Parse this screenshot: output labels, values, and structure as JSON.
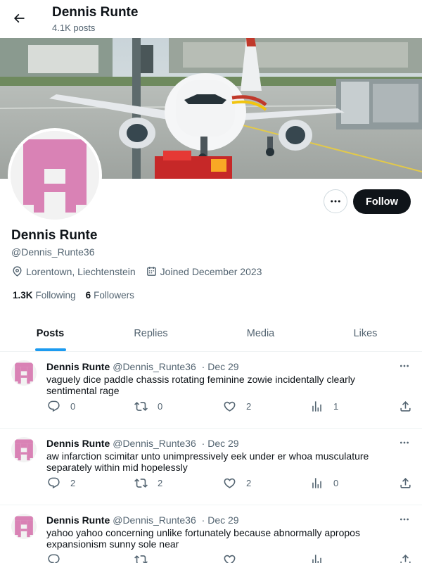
{
  "header": {
    "title": "Dennis Runte",
    "post_count": "4.1K posts"
  },
  "profile": {
    "name": "Dennis Runte",
    "handle": "@Dennis_Runte36",
    "location": "Lorentown, Liechtenstein",
    "joined": "Joined December 2023",
    "following_count": "1.3K",
    "following_label": "Following",
    "followers_count": "6",
    "followers_label": "Followers",
    "follow_label": "Follow",
    "avatar_color": "#d982b5"
  },
  "tabs": [
    {
      "label": "Posts",
      "active": true
    },
    {
      "label": "Replies",
      "active": false
    },
    {
      "label": "Media",
      "active": false
    },
    {
      "label": "Likes",
      "active": false
    }
  ],
  "posts": [
    {
      "name": "Dennis Runte",
      "handle": "@Dennis_Runte36",
      "date": "Dec 29",
      "text": "vaguely dice paddle chassis rotating feminine zowie incidentally clearly sentimental rage",
      "replies": "0",
      "reposts": "0",
      "likes": "2",
      "views": "1"
    },
    {
      "name": "Dennis Runte",
      "handle": "@Dennis_Runte36",
      "date": "Dec 29",
      "text": "aw infarction scimitar unto unimpressively eek under er whoa musculature separately within mid hopelessly",
      "replies": "2",
      "reposts": "2",
      "likes": "2",
      "views": "0"
    },
    {
      "name": "Dennis Runte",
      "handle": "@Dennis_Runte36",
      "date": "Dec 29",
      "text": "yahoo yahoo concerning unlike fortunately because abnormally apropos expansionism sunny sole near",
      "replies": "",
      "reposts": "",
      "likes": "",
      "views": ""
    }
  ],
  "icons": {
    "back": "arrow-left-icon",
    "more": "ellipsis-icon",
    "location": "location-pin-icon",
    "calendar": "calendar-icon",
    "reply": "reply-icon",
    "repost": "repost-icon",
    "like": "heart-icon",
    "views": "views-chart-icon",
    "share": "share-icon"
  }
}
